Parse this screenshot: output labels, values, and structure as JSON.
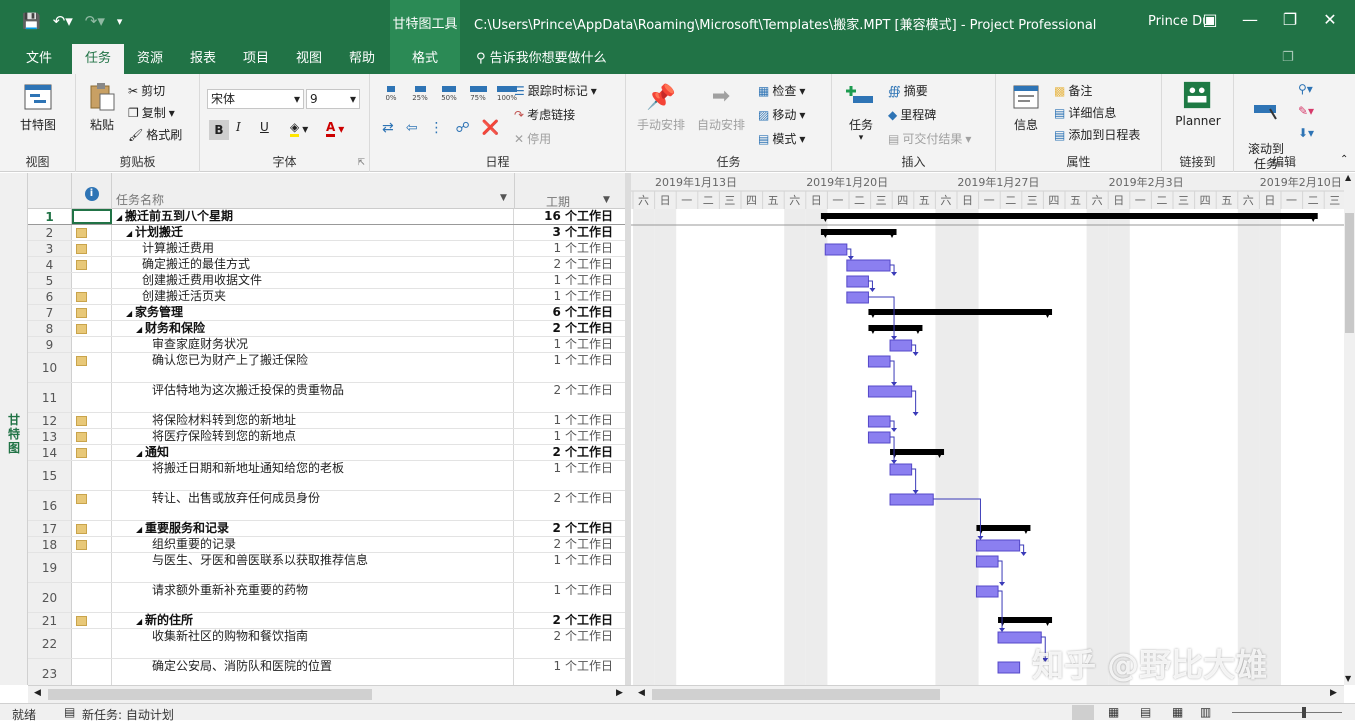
{
  "window": {
    "title": "C:\\Users\\Prince\\AppData\\Roaming\\Microsoft\\Templates\\搬家.MPT [兼容模式] - Project Professional",
    "contextual_tools": "甘特图工具",
    "user": "Prince Du"
  },
  "tabs": [
    "文件",
    "任务",
    "资源",
    "报表",
    "项目",
    "视图",
    "帮助",
    "格式"
  ],
  "active_tab": "任务",
  "tellme": "告诉我你想要做什么",
  "ribbon": {
    "view": {
      "label": "视图",
      "gantt": "甘特图"
    },
    "clipboard": {
      "label": "剪贴板",
      "paste": "粘贴",
      "cut": "剪切",
      "copy": "复制",
      "format_painter": "格式刷"
    },
    "font": {
      "label": "字体",
      "font_name": "宋体",
      "font_size": "9",
      "bold": "B",
      "italic": "I",
      "underline": "U"
    },
    "schedule": {
      "label": "日程",
      "pct": [
        "0%",
        "25%",
        "50%",
        "75%",
        "100%"
      ],
      "track": "跟踪时标记",
      "respect_links": "考虑链接",
      "inactivate": "停用"
    },
    "tasks": {
      "label": "任务",
      "manual": "手动安排",
      "auto": "自动安排",
      "inspect": "检查",
      "move": "移动",
      "mode": "模式"
    },
    "insert": {
      "label": "插入",
      "task": "任务",
      "summary": "摘要",
      "milestone": "里程碑",
      "deliverable": "可交付结果"
    },
    "properties": {
      "label": "属性",
      "info": "信息",
      "notes": "备注",
      "details": "详细信息",
      "add_timeline": "添加到日程表"
    },
    "link": {
      "label": "链接到",
      "planner": "Planner"
    },
    "edit": {
      "label": "编辑",
      "scroll": "滚动到\n任务"
    }
  },
  "sidebar_label": "甘特图",
  "columns": {
    "name": "任务名称",
    "duration": "工期"
  },
  "timeline": {
    "weeks": [
      "2019年1月13日",
      "2019年1月20日",
      "2019年1月27日",
      "2019年2月3日",
      "2019年2月10日"
    ],
    "days": [
      "六",
      "日",
      "一",
      "二",
      "三",
      "四",
      "五",
      "六",
      "日",
      "一",
      "二",
      "三",
      "四",
      "五",
      "六",
      "日",
      "一",
      "二",
      "三",
      "四",
      "五",
      "六",
      "日",
      "一",
      "二",
      "三",
      "四",
      "五",
      "六",
      "日",
      "一",
      "二",
      "三"
    ]
  },
  "rows": [
    {
      "id": "1",
      "name": "搬迁前五到八个星期",
      "dur": "16 个工作日",
      "level": 0,
      "summary": true,
      "note": false,
      "h": 16
    },
    {
      "id": "2",
      "name": "计划搬迁",
      "dur": "3 个工作日",
      "level": 1,
      "summary": true,
      "note": true,
      "h": 16
    },
    {
      "id": "3",
      "name": "计算搬迁费用",
      "dur": "1 个工作日",
      "level": 2,
      "summary": false,
      "note": true,
      "h": 16
    },
    {
      "id": "4",
      "name": "确定搬迁的最佳方式",
      "dur": "2 个工作日",
      "level": 2,
      "summary": false,
      "note": true,
      "h": 16
    },
    {
      "id": "5",
      "name": "创建搬迁费用收据文件",
      "dur": "1 个工作日",
      "level": 2,
      "summary": false,
      "note": false,
      "h": 16
    },
    {
      "id": "6",
      "name": "创建搬迁活页夹",
      "dur": "1 个工作日",
      "level": 2,
      "summary": false,
      "note": true,
      "h": 16
    },
    {
      "id": "7",
      "name": "家务管理",
      "dur": "6 个工作日",
      "level": 1,
      "summary": true,
      "note": true,
      "h": 16
    },
    {
      "id": "8",
      "name": "财务和保险",
      "dur": "2 个工作日",
      "level": 2,
      "summary": true,
      "note": true,
      "h": 16
    },
    {
      "id": "9",
      "name": "审查家庭财务状况",
      "dur": "1 个工作日",
      "level": 3,
      "summary": false,
      "note": false,
      "h": 16
    },
    {
      "id": "10",
      "name": "确认您已为财产上了搬迁保险",
      "dur": "1 个工作日",
      "level": 3,
      "summary": false,
      "note": true,
      "h": 30
    },
    {
      "id": "11",
      "name": "评估特地为这次搬迁投保的贵重物品",
      "dur": "2 个工作日",
      "level": 3,
      "summary": false,
      "note": false,
      "h": 30
    },
    {
      "id": "12",
      "name": "将保险材料转到您的新地址",
      "dur": "1 个工作日",
      "level": 3,
      "summary": false,
      "note": true,
      "h": 16
    },
    {
      "id": "13",
      "name": "将医疗保险转到您的新地点",
      "dur": "1 个工作日",
      "level": 3,
      "summary": false,
      "note": true,
      "h": 16
    },
    {
      "id": "14",
      "name": "通知",
      "dur": "2 个工作日",
      "level": 2,
      "summary": true,
      "note": true,
      "h": 16
    },
    {
      "id": "15",
      "name": "将搬迁日期和新地址通知给您的老板",
      "dur": "1 个工作日",
      "level": 3,
      "summary": false,
      "note": false,
      "h": 30
    },
    {
      "id": "16",
      "name": "转让、出售或放弃任何成员身份",
      "dur": "2 个工作日",
      "level": 3,
      "summary": false,
      "note": true,
      "h": 30
    },
    {
      "id": "17",
      "name": "重要服务和记录",
      "dur": "2 个工作日",
      "level": 2,
      "summary": true,
      "note": true,
      "h": 16
    },
    {
      "id": "18",
      "name": "组织重要的记录",
      "dur": "2 个工作日",
      "level": 3,
      "summary": false,
      "note": true,
      "h": 16
    },
    {
      "id": "19",
      "name": "与医生、牙医和兽医联系以获取推荐信息",
      "dur": "1 个工作日",
      "level": 3,
      "summary": false,
      "note": false,
      "h": 30
    },
    {
      "id": "20",
      "name": "请求额外重新补充重要的药物",
      "dur": "1 个工作日",
      "level": 3,
      "summary": false,
      "note": false,
      "h": 30
    },
    {
      "id": "21",
      "name": "新的住所",
      "dur": "2 个工作日",
      "level": 2,
      "summary": true,
      "note": true,
      "h": 16
    },
    {
      "id": "22",
      "name": "收集新社区的购物和餐饮指南",
      "dur": "2 个工作日",
      "level": 3,
      "summary": false,
      "note": false,
      "h": 30
    },
    {
      "id": "23",
      "name": "确定公安局、消防队和医院的位置",
      "dur": "1 个工作日",
      "level": 3,
      "summary": false,
      "note": false,
      "h": 30
    }
  ],
  "bars": [
    {
      "row": 0,
      "start": 8.7,
      "days": 23,
      "type": "summary"
    },
    {
      "row": 1,
      "start": 8.7,
      "days": 3.5,
      "type": "summary"
    },
    {
      "row": 2,
      "start": 8.9,
      "days": 1,
      "type": "task"
    },
    {
      "row": 3,
      "start": 9.9,
      "days": 2,
      "type": "task"
    },
    {
      "row": 4,
      "start": 9.9,
      "days": 1,
      "type": "task"
    },
    {
      "row": 5,
      "start": 9.9,
      "days": 1,
      "type": "task"
    },
    {
      "row": 6,
      "start": 10.9,
      "days": 8.5,
      "type": "summary"
    },
    {
      "row": 7,
      "start": 10.9,
      "days": 2.5,
      "type": "summary"
    },
    {
      "row": 8,
      "start": 11.9,
      "days": 1,
      "type": "task"
    },
    {
      "row": 9,
      "start": 10.9,
      "days": 1,
      "type": "task"
    },
    {
      "row": 10,
      "start": 10.9,
      "days": 2,
      "type": "task"
    },
    {
      "row": 11,
      "start": 10.9,
      "days": 1,
      "type": "task"
    },
    {
      "row": 12,
      "start": 10.9,
      "days": 1,
      "type": "task"
    },
    {
      "row": 13,
      "start": 11.9,
      "days": 2.5,
      "type": "summary"
    },
    {
      "row": 14,
      "start": 11.9,
      "days": 1,
      "type": "task"
    },
    {
      "row": 15,
      "start": 11.9,
      "days": 2,
      "type": "task"
    },
    {
      "row": 16,
      "start": 15.9,
      "days": 2.5,
      "type": "summary"
    },
    {
      "row": 17,
      "start": 15.9,
      "days": 2,
      "type": "task"
    },
    {
      "row": 18,
      "start": 15.9,
      "days": 1,
      "type": "task"
    },
    {
      "row": 19,
      "start": 15.9,
      "days": 1,
      "type": "task"
    },
    {
      "row": 20,
      "start": 16.9,
      "days": 2.5,
      "type": "summary"
    },
    {
      "row": 21,
      "start": 16.9,
      "days": 2,
      "type": "task"
    },
    {
      "row": 22,
      "start": 16.9,
      "days": 1,
      "type": "task"
    }
  ],
  "status": {
    "ready": "就绪",
    "new_task": "新任务: 自动计划"
  },
  "watermark": "知乎 @野比大雄",
  "colors": {
    "brand": "#217346",
    "task_bar": "#8b7ff0",
    "summary_bar": "#000000",
    "note": "#e8c878"
  }
}
